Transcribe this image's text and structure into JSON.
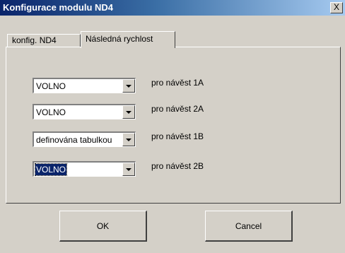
{
  "window": {
    "title": "Konfigurace modulu ND4",
    "close_label": "X"
  },
  "tabs": [
    {
      "label": "konfig. ND4",
      "active": false
    },
    {
      "label": "Následná rychlost",
      "active": true
    }
  ],
  "rows": [
    {
      "value": "VOLNO",
      "label": "pro návěst 1A",
      "selected": false
    },
    {
      "value": "VOLNO",
      "label": "pro návěst 2A",
      "selected": false
    },
    {
      "value": "definována tabulkou",
      "label": "pro návěst 1B",
      "selected": false
    },
    {
      "value": "VOLNO",
      "label": "pro návěst 2B",
      "selected": true
    }
  ],
  "buttons": {
    "ok": "OK",
    "cancel": "Cancel"
  },
  "colors": {
    "title_start": "#0a246a",
    "title_end": "#a6caf0",
    "face": "#d4d0c8",
    "selection": "#0a246a"
  }
}
